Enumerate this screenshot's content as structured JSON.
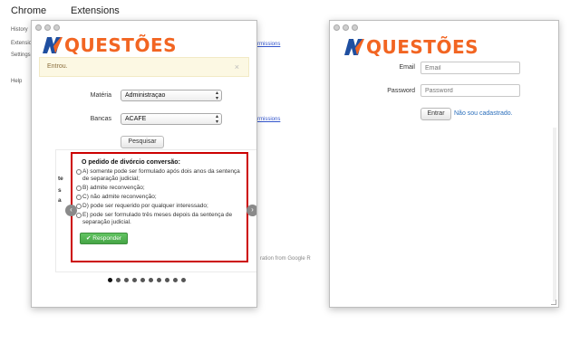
{
  "background": {
    "chrome_label": "Chrome",
    "extensions_label": "Extensions",
    "nav": [
      "History",
      "Extensions",
      "Settings",
      "Help"
    ],
    "permissions_link": "rmissions",
    "footer_text": "ration from Google R"
  },
  "left_popup": {
    "logo_text": "QUESTÕES",
    "alert": "Entrou.",
    "alert_close": "×",
    "materia_label": "Matéria",
    "materia_value": "Administraçao",
    "bancas_label": "Bancas",
    "bancas_value": "ACAFE",
    "search_button": "Pesquisar",
    "question_title": "O pedido de divórcio conversão:",
    "options": [
      "A) somente pode ser formulado após dois anos da sentença de separação judicial;",
      "B) admite reconvenção;",
      "C) não admite reconvenção;",
      "D) pode ser requerido por qualquer interessado;",
      "E) pode ser formulado três meses depois da sentença de separação judicial."
    ],
    "answer_button": "✔ Responder",
    "side_fragments": [
      "te",
      "s",
      "a"
    ],
    "prev_arrow": "‹",
    "next_arrow": "›",
    "indicator_count": 10,
    "active_indicator": 0
  },
  "right_popup": {
    "logo_text": "QUESTÕES",
    "email_label": "Email",
    "email_placeholder": "Email",
    "password_label": "Password",
    "password_placeholder": "Password",
    "enter_button": "Entrar",
    "register_link": "Não sou cadastrado."
  },
  "colors": {
    "logo_orange": "#f26522",
    "logo_blue": "#1f4fa0",
    "alert_bg": "#fcf8e3",
    "question_border": "#cc0000",
    "answer_green": "#46a546",
    "link_blue": "#2a6ebb"
  }
}
